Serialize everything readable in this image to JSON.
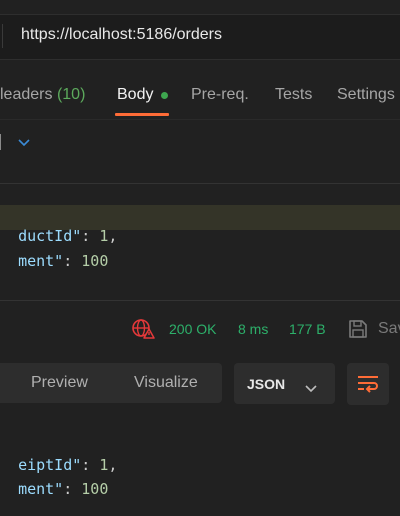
{
  "url_bar": {
    "url": "https://localhost:5186/orders"
  },
  "request_tabs": [
    {
      "label": "leaders",
      "count": "(10)"
    },
    {
      "label": "Body"
    },
    {
      "label": "Pre-req."
    },
    {
      "label": "Tests"
    },
    {
      "label": "Settings"
    }
  ],
  "request_body": {
    "lines": [
      {
        "key": "ductId\"",
        "sep": ": ",
        "value": "1",
        "end": ","
      },
      {
        "key": "ment\"",
        "sep": ": ",
        "value": "100",
        "end": ""
      }
    ]
  },
  "response_status": {
    "status": "200 OK",
    "time": "8 ms",
    "size": "177 B",
    "save_label": "Sav"
  },
  "response_tabs": {
    "preview": "Preview",
    "visualize": "Visualize"
  },
  "format_select": {
    "value": "JSON"
  },
  "response_body": {
    "lines": [
      {
        "key": "eiptId\"",
        "sep": ": ",
        "value": "1",
        "end": ","
      },
      {
        "key": "ment\"",
        "sep": ": ",
        "value": "100",
        "end": ""
      }
    ]
  },
  "colors": {
    "accent": "#ff6c37",
    "status_ok": "#2db06a",
    "body_dot": "#3ea64f",
    "globe_error": "#e5393a",
    "code_key": "#9cdcfe",
    "code_number": "#b5cea8"
  },
  "icons": [
    "chevron-down-icon",
    "globe-error-icon",
    "save-icon",
    "wrap-lines-icon"
  ]
}
